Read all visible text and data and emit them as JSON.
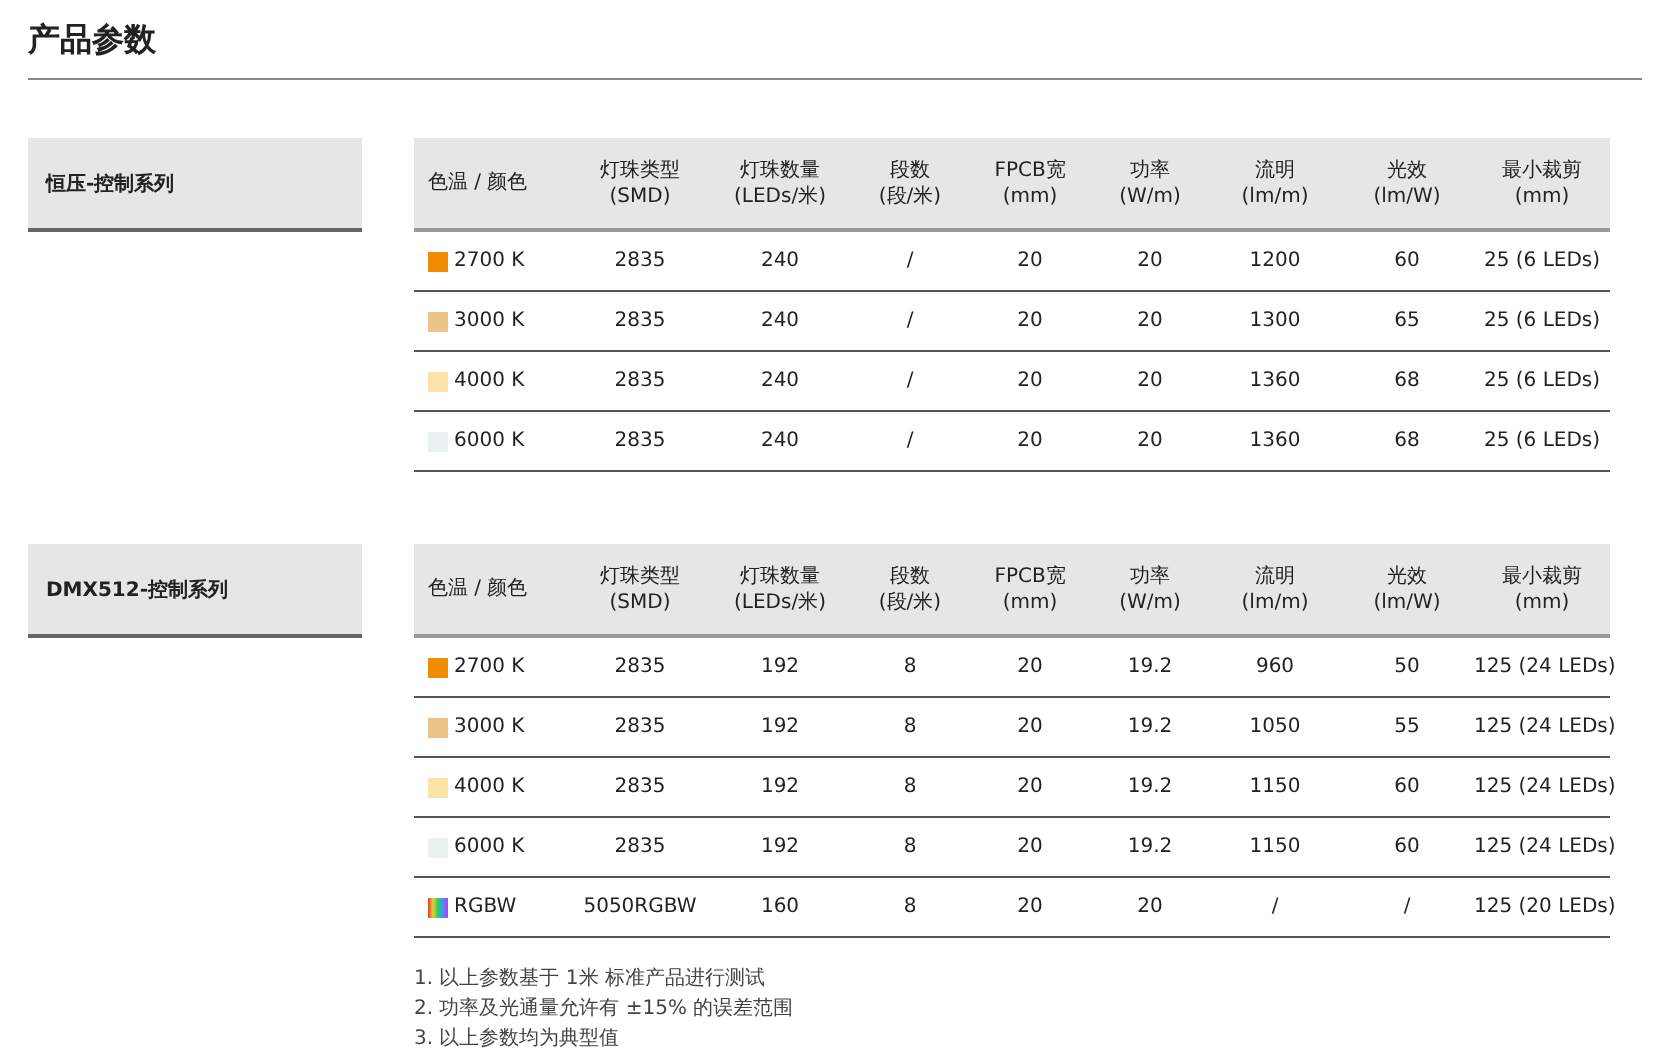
{
  "title": "产品参数",
  "sections": [
    {
      "series": "恒压-控制系列",
      "columns": [
        {
          "title": "色温 / 颜色"
        },
        {
          "title": "灯珠类型",
          "unit": "(SMD)"
        },
        {
          "title": "灯珠数量",
          "unit": "(LEDs/米)"
        },
        {
          "title": "段数",
          "unit": "(段/米)"
        },
        {
          "title": "FPCB宽",
          "unit": "(mm)"
        },
        {
          "title": "功率",
          "unit": "(W/m)"
        },
        {
          "title": "流明",
          "unit": "(lm/m)"
        },
        {
          "title": "光效",
          "unit": "(lm/W)"
        },
        {
          "title": "最小裁剪",
          "unit": "(mm)"
        }
      ],
      "rows": [
        {
          "kind": "swatch",
          "color": "#f08c00",
          "cells": [
            "2700 K",
            "2835",
            "240",
            "/",
            "20",
            "20",
            "1200",
            "60",
            "25 (6 LEDs)"
          ]
        },
        {
          "kind": "swatch",
          "color": "#ecc487",
          "cells": [
            "3000 K",
            "2835",
            "240",
            "/",
            "20",
            "20",
            "1300",
            "65",
            "25 (6 LEDs)"
          ]
        },
        {
          "kind": "swatch",
          "color": "#fbe3a8",
          "cells": [
            "4000 K",
            "2835",
            "240",
            "/",
            "20",
            "20",
            "1360",
            "68",
            "25 (6 LEDs)"
          ]
        },
        {
          "kind": "swatch",
          "color": "#eaf1f0",
          "cells": [
            "6000 K",
            "2835",
            "240",
            "/",
            "20",
            "20",
            "1360",
            "68",
            "25 (6 LEDs)"
          ]
        }
      ]
    },
    {
      "series": "DMX512-控制系列",
      "columns": [
        {
          "title": "色温 / 颜色"
        },
        {
          "title": "灯珠类型",
          "unit": "(SMD)"
        },
        {
          "title": "灯珠数量",
          "unit": "(LEDs/米)"
        },
        {
          "title": "段数",
          "unit": "(段/米)"
        },
        {
          "title": "FPCB宽",
          "unit": "(mm)"
        },
        {
          "title": "功率",
          "unit": "(W/m)"
        },
        {
          "title": "流明",
          "unit": "(lm/m)"
        },
        {
          "title": "光效",
          "unit": "(lm/W)"
        },
        {
          "title": "最小裁剪",
          "unit": "(mm)"
        }
      ],
      "rows": [
        {
          "kind": "swatch",
          "color": "#f08c00",
          "cells": [
            "2700 K",
            "2835",
            "192",
            "8",
            "20",
            "19.2",
            "960",
            "50",
            "125 (24 LEDs)"
          ]
        },
        {
          "kind": "swatch",
          "color": "#ecc487",
          "cells": [
            "3000 K",
            "2835",
            "192",
            "8",
            "20",
            "19.2",
            "1050",
            "55",
            "125 (24 LEDs)"
          ]
        },
        {
          "kind": "swatch",
          "color": "#fbe3a8",
          "cells": [
            "4000 K",
            "2835",
            "192",
            "8",
            "20",
            "19.2",
            "1150",
            "60",
            "125 (24 LEDs)"
          ]
        },
        {
          "kind": "swatch",
          "color": "#eaf1f0",
          "cells": [
            "6000 K",
            "2835",
            "192",
            "8",
            "20",
            "19.2",
            "1150",
            "60",
            "125 (24 LEDs)"
          ]
        },
        {
          "kind": "spectrum",
          "cells": [
            "RGBW",
            "5050RGBW",
            "160",
            "8",
            "20",
            "20",
            "/",
            "/",
            "125 (20 LEDs)"
          ]
        }
      ]
    }
  ],
  "notes": [
    "1. 以上参数基于 1米 标准产品进行测试",
    "2. 功率及光通量允许有 ±15% 的误差范围",
    "3. 以上参数均为典型值"
  ]
}
